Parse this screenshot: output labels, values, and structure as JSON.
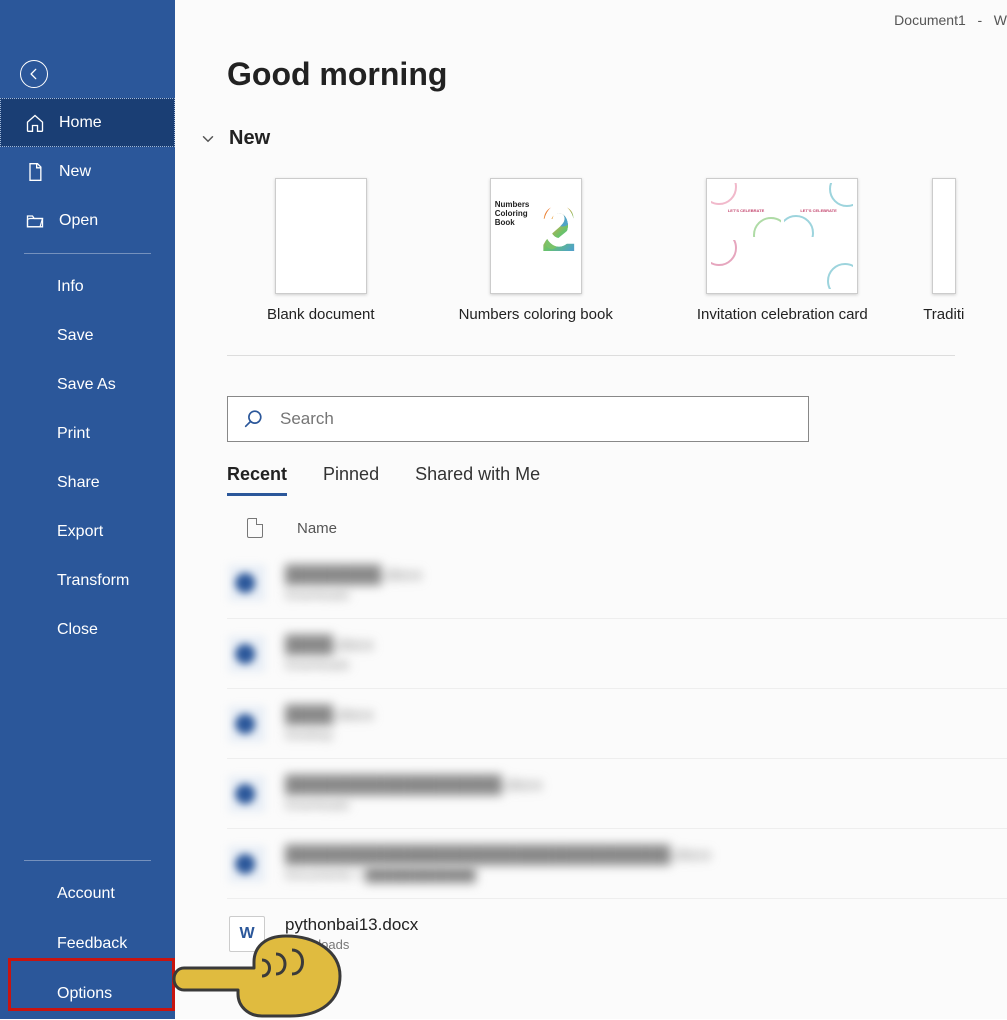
{
  "titlebar": {
    "doc": "Document1",
    "sep": "-",
    "app": "W"
  },
  "greeting": "Good morning",
  "sidebar": {
    "primary": [
      {
        "label": "Home",
        "icon": "home-icon",
        "active": true
      },
      {
        "label": "New",
        "icon": "new-doc-icon"
      },
      {
        "label": "Open",
        "icon": "open-folder-icon"
      }
    ],
    "secondary": [
      {
        "label": "Info"
      },
      {
        "label": "Save"
      },
      {
        "label": "Save As"
      },
      {
        "label": "Print"
      },
      {
        "label": "Share"
      },
      {
        "label": "Export"
      },
      {
        "label": "Transform"
      },
      {
        "label": "Close"
      }
    ],
    "bottom": [
      {
        "label": "Account"
      },
      {
        "label": "Feedback"
      },
      {
        "label": "Options"
      }
    ]
  },
  "new_section": {
    "heading": "New",
    "templates": [
      {
        "label": "Blank document"
      },
      {
        "label": "Numbers coloring book",
        "thumb_text": "Numbers Coloring Book"
      },
      {
        "label": "Invitation celebration card",
        "thumb_text": "LET'S CELEBRATE"
      },
      {
        "label": "Traditi"
      }
    ]
  },
  "search": {
    "placeholder": "Search"
  },
  "tabs": [
    {
      "label": "Recent",
      "active": true
    },
    {
      "label": "Pinned"
    },
    {
      "label": "Shared with Me"
    }
  ],
  "name_column": "Name",
  "files": [
    {
      "name": "████████.docx",
      "location": "Downloads",
      "blurred": true
    },
    {
      "name": "████.docx",
      "location": "Downloads",
      "blurred": true
    },
    {
      "name": "████.docx",
      "location": "Desktop",
      "blurred": true
    },
    {
      "name": "██████████████████.docx",
      "location": "Downloads",
      "blurred": true
    },
    {
      "name": "████████████████████████████████.docx",
      "location": "Documents » ████████████",
      "blurred": true
    },
    {
      "name": "pythonbai13.docx",
      "location": "Downloads",
      "blurred": false
    }
  ]
}
